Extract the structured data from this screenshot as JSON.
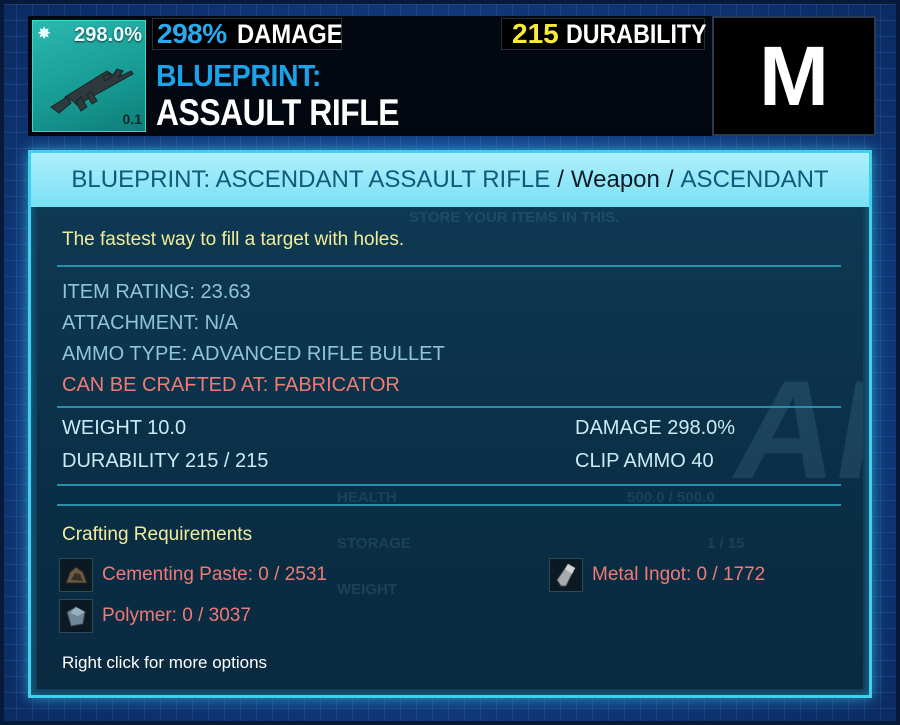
{
  "header": {
    "thumbnail": {
      "damage_pct": "298.0%",
      "weight": "0.1",
      "icon": "assault-rifle-icon",
      "star_icon": "star-burst-icon"
    },
    "damage": {
      "value": "298%",
      "label": "DAMAGE"
    },
    "durability": {
      "value": "215",
      "label": "DURABILITY"
    },
    "blueprint_label": "BLUEPRINT:",
    "item_name": "ASSAULT RIFLE",
    "hotkey": "M"
  },
  "tooltip": {
    "title": {
      "name": "BLUEPRINT: ASCENDANT ASSAULT RIFLE",
      "sep1": "/",
      "type": "Weapon",
      "sep2": "/",
      "tier": "ASCENDANT"
    },
    "description": "The fastest way to fill a target with holes.",
    "stats": {
      "item_rating": "ITEM RATING: 23.63",
      "attachment": "ATTACHMENT: N/A",
      "ammo_type": "AMMO TYPE: ADVANCED RIFLE BULLET",
      "crafted_at": "CAN BE CRAFTED AT: FABRICATOR"
    },
    "values": {
      "weight": "WEIGHT 10.0",
      "damage": "DAMAGE 298.0%",
      "durability": "DURABILITY 215 / 215",
      "clip_ammo": "CLIP AMMO 40"
    },
    "crafting": {
      "title": "Crafting Requirements",
      "resources": [
        {
          "name": "Cementing Paste: 0 / 2531",
          "icon": "cementing-paste-icon"
        },
        {
          "name": "Metal Ingot: 0 / 1772",
          "icon": "metal-ingot-icon"
        },
        {
          "name": "Polymer: 0 / 3037",
          "icon": "polymer-icon"
        }
      ]
    },
    "hint": "Right click for more options"
  },
  "background_ghost_text": {
    "store": "STORE YOUR ITEMS IN THIS.",
    "health": "HEALTH",
    "storage": "STORAGE",
    "weight": "WEIGHT",
    "health_value": "500.0 / 500.0",
    "storage_value": "1 / 15",
    "logo": "AR"
  },
  "colors": {
    "damage_accent": "#27aaf0",
    "durability_accent": "#f7ea3c",
    "panel_border": "#3fd0ee",
    "crafted_text": "#f07a74",
    "description_text": "#f2ec9a"
  }
}
